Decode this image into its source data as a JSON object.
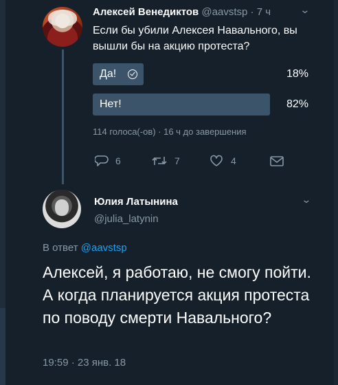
{
  "tweet1": {
    "author_name": "Алексей Венедиктов",
    "author_handle": "@aavstsp",
    "separator": "·",
    "time": "7 ч",
    "text": "Если бы убили Алексея Навального, вы вышли бы на акцию протеста?",
    "poll": {
      "options": [
        {
          "label": "Да!",
          "percent": "18%",
          "value": 18,
          "selected": true
        },
        {
          "label": "Нет!",
          "percent": "82%",
          "value": 82,
          "selected": false
        }
      ],
      "meta": "114 голоса(-ов) · 16 ч до завершения"
    },
    "actions": {
      "reply_count": "6",
      "retweet_count": "7",
      "like_count": "4"
    }
  },
  "tweet2": {
    "author_name": "Юлия Латынина",
    "author_handle": "@julia_latynin",
    "reply_prefix": "В ответ",
    "reply_handle": "@aavstsp",
    "text": "Алексей, я работаю, не смогу пойти. А когда планируется акция протеста по поводу смерти Навального?",
    "timestamp": "19:59 · 23 янв. 18"
  },
  "icons": {
    "reply": "reply-icon",
    "retweet": "retweet-icon",
    "like": "heart-icon",
    "message": "envelope-icon",
    "menu": "chevron-down-icon",
    "selected": "check-circle-icon"
  },
  "colors": {
    "background": "#15202b",
    "poll_bar": "#3b5469",
    "secondary_text": "#8899a6",
    "link": "#1da1f2"
  }
}
